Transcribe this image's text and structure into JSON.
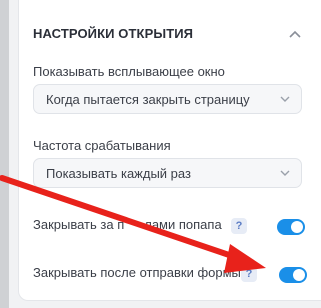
{
  "section": {
    "title": "НАСТРОЙКИ ОТКРЫТИЯ"
  },
  "popup_show": {
    "label": "Показывать всплывающее окно",
    "selected": "Когда пытается закрыть страницу"
  },
  "frequency": {
    "label": "Частота срабатывания",
    "selected": "Показывать каждый раз"
  },
  "close_outside": {
    "label_left": "Закрывать за п",
    "label_right": "лами попапа",
    "help": "?",
    "enabled": true
  },
  "close_after_submit": {
    "label": "Закрывать после отправки формы",
    "help": "?",
    "enabled": true
  },
  "colors": {
    "accent": "#1a8fe8",
    "annotation_arrow": "#e8221b"
  }
}
